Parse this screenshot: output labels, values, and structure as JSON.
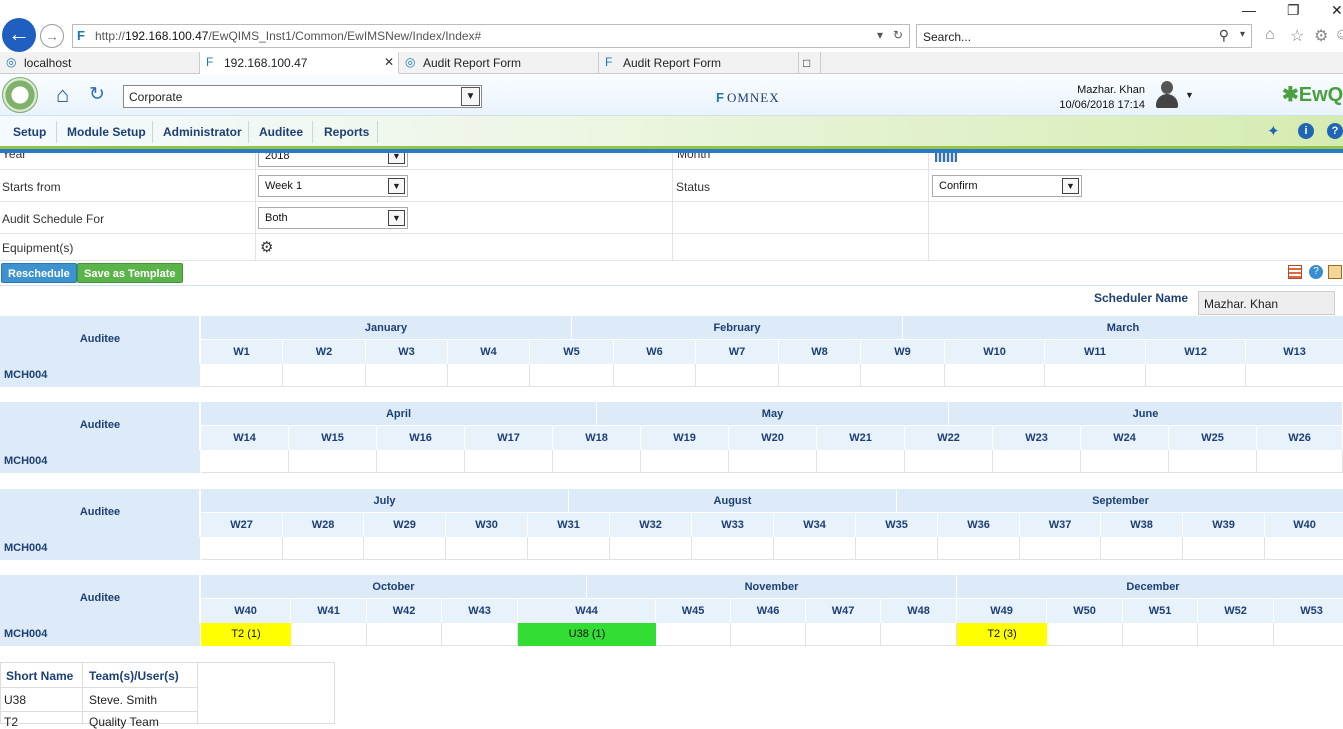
{
  "browser": {
    "url_prefix": "http://",
    "url_host": "192.168.100.47",
    "url_path": "/EwQIMS_Inst1/Common/EwIMSNew/Index/Index#",
    "search_placeholder": "Search...",
    "tabs": [
      {
        "label": "localhost"
      },
      {
        "label": "192.168.100.47"
      },
      {
        "label": "Audit Report Form"
      },
      {
        "label": "Audit Report Form"
      }
    ]
  },
  "header": {
    "site_value": "Corporate",
    "brand_center": "OMNEX",
    "user_name": "Mazhar. Khan",
    "user_datetime": "10/06/2018 17:14",
    "brand_right": "EwQ"
  },
  "menu": {
    "items": [
      "Setup",
      "Module Setup",
      "Administrator",
      "Auditee",
      "Reports"
    ]
  },
  "form": {
    "starts_from_label": "Starts from",
    "starts_from_value": "Week 1",
    "status_label": "Status",
    "status_value": "Confirm",
    "audit_schedule_for_label": "Audit Schedule For",
    "audit_schedule_for_value": "Both",
    "equipment_label": "Equipment(s)",
    "top_label_left": "Year",
    "top_value_left": "2018",
    "top_label_right": "Month"
  },
  "actions": {
    "reschedule": "Reschedule",
    "save_template": "Save as Template"
  },
  "scheduler": {
    "label": "Scheduler Name",
    "value": "Mazhar.  Khan"
  },
  "schedule": {
    "row_header": "Auditee",
    "auditee": "MCH004",
    "quarters": [
      {
        "months": [
          "January",
          "February",
          "March"
        ],
        "weeks": [
          "W1",
          "W2",
          "W3",
          "W4",
          "W5",
          "W6",
          "W7",
          "W8",
          "W9",
          "W10",
          "W11",
          "W12",
          "W13"
        ],
        "events": []
      },
      {
        "months": [
          "April",
          "May",
          "June"
        ],
        "weeks": [
          "W14",
          "W15",
          "W16",
          "W17",
          "W18",
          "W19",
          "W20",
          "W21",
          "W22",
          "W23",
          "W24",
          "W25",
          "W26"
        ],
        "events": []
      },
      {
        "months": [
          "July",
          "August",
          "September"
        ],
        "weeks": [
          "W27",
          "W28",
          "W29",
          "W30",
          "W31",
          "W32",
          "W33",
          "W34",
          "W35",
          "W36",
          "W37",
          "W38",
          "W39",
          "W40"
        ],
        "events": []
      },
      {
        "months": [
          "October",
          "November",
          "December"
        ],
        "weeks": [
          "W40",
          "W41",
          "W42",
          "W43",
          "W44",
          "W45",
          "W46",
          "W47",
          "W48",
          "W49",
          "W50",
          "W51",
          "W52",
          "W53"
        ],
        "events": [
          {
            "week": "W40",
            "label": "T2 (1)",
            "color": "#ffff00"
          },
          {
            "week": "W44",
            "label": "U38 (1)",
            "color": "#33dd33"
          },
          {
            "week": "W49",
            "label": "T2 (3)",
            "color": "#ffff00"
          }
        ]
      }
    ]
  },
  "legend": {
    "col_short": "Short Name",
    "col_team": "Team(s)/User(s)",
    "rows": [
      {
        "short": "U38",
        "team": "Steve. Smith"
      },
      {
        "short": "T2",
        "team": "Quality Team"
      }
    ]
  }
}
